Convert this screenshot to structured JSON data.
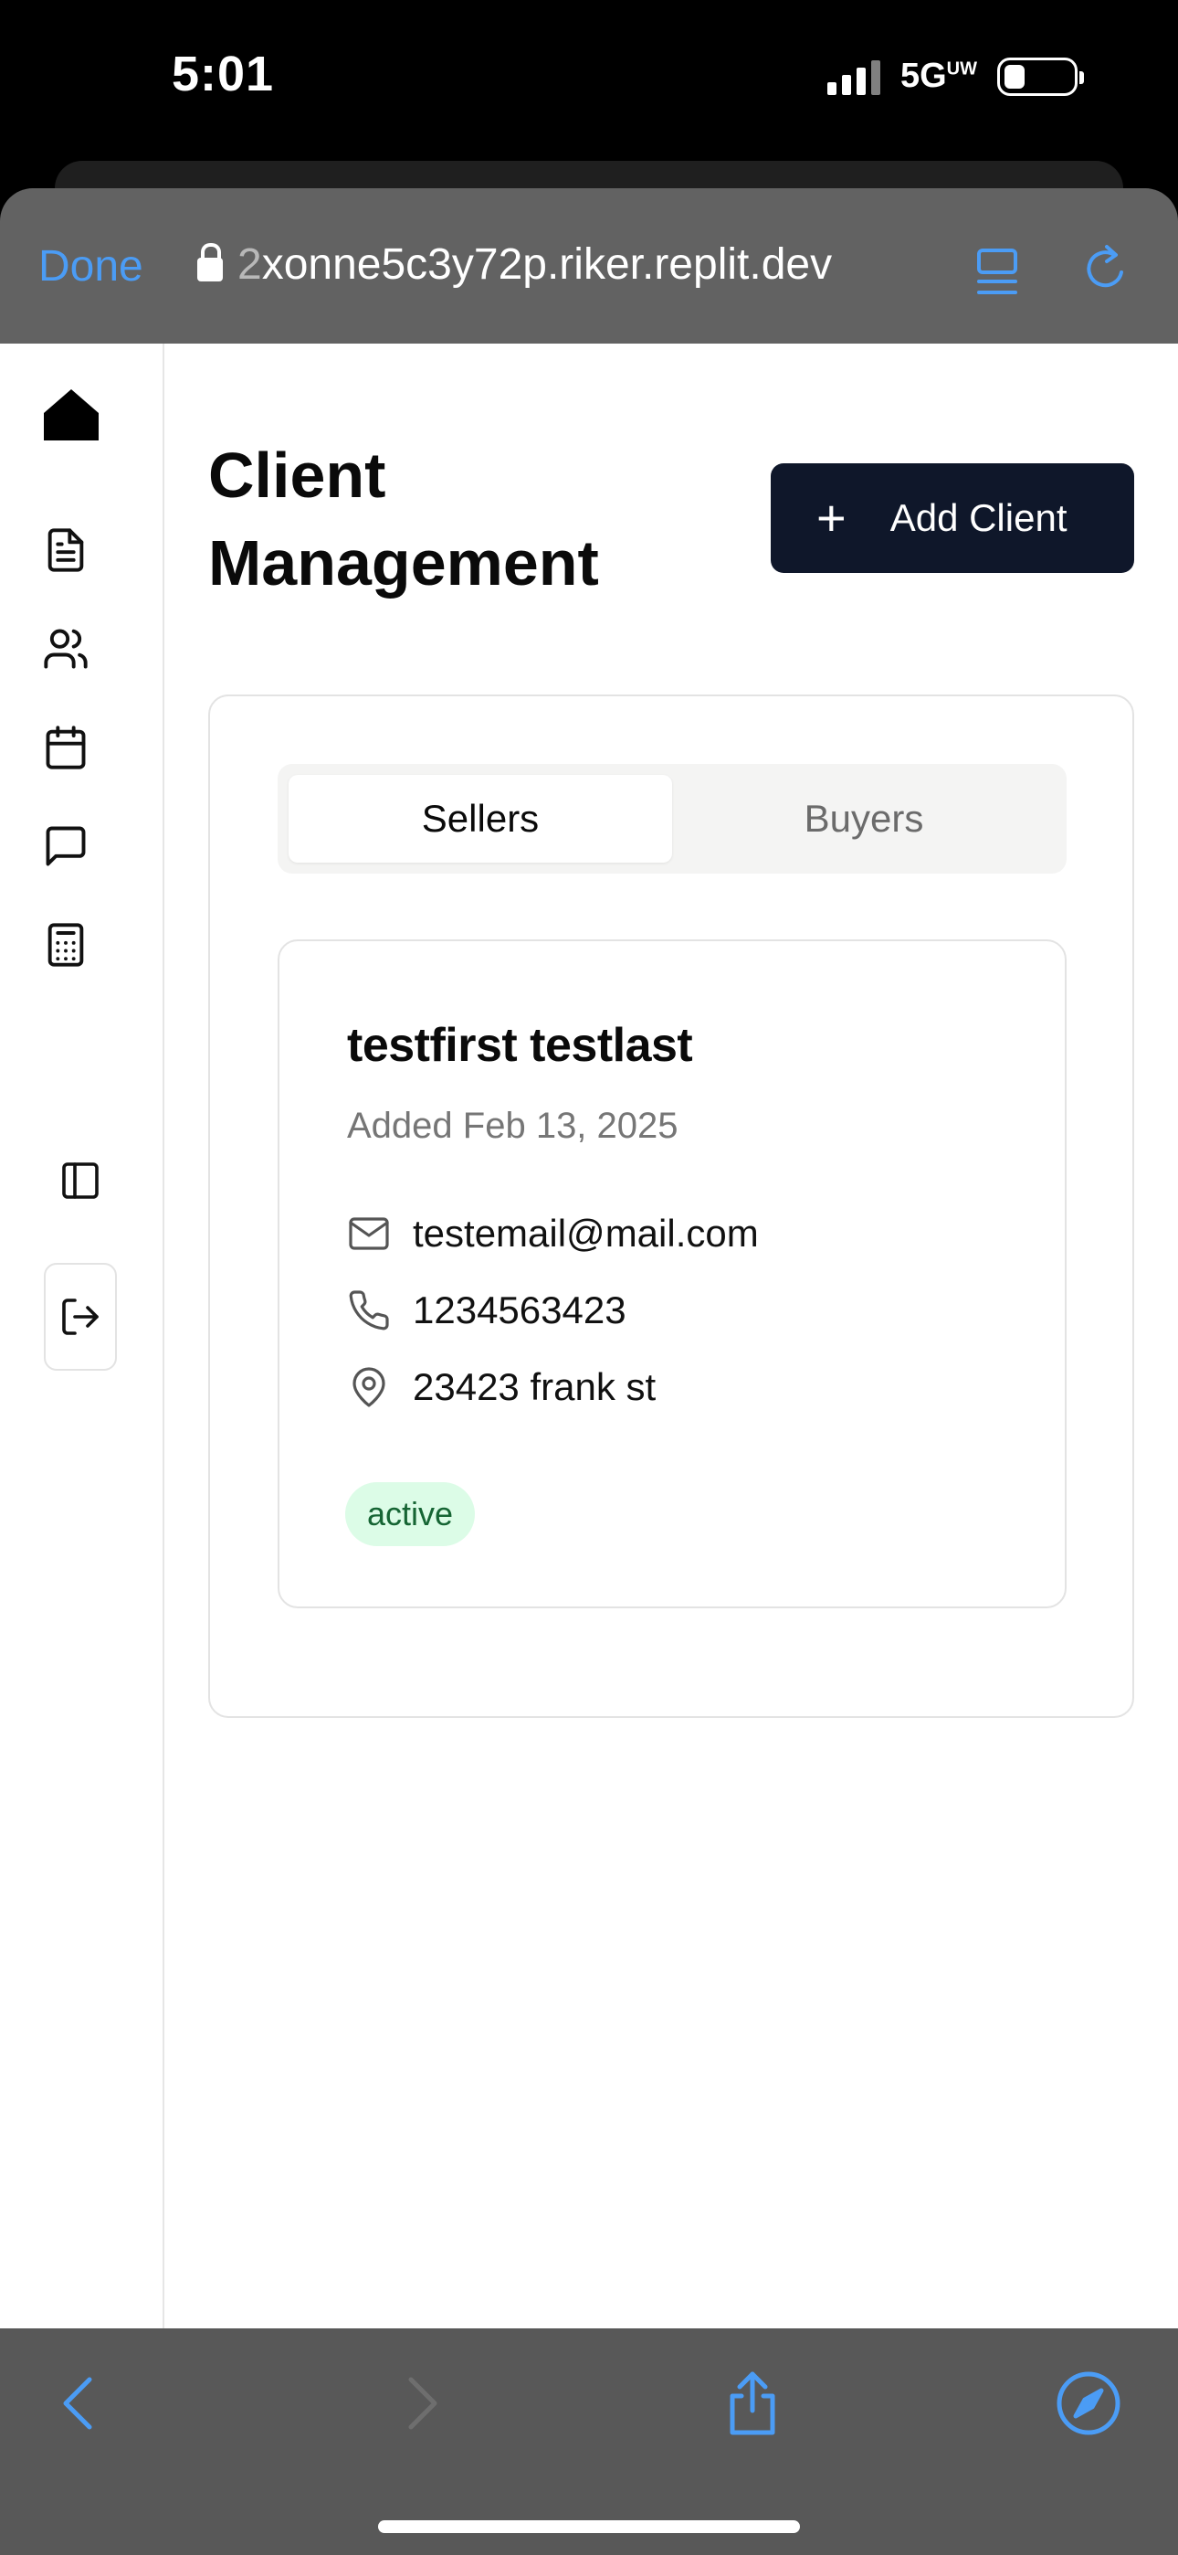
{
  "status_bar": {
    "time": "5:01",
    "network": "5G",
    "network_suffix": "UW"
  },
  "browser": {
    "done_label": "Done",
    "url_first_char": "2",
    "url_rest": "xonne5c3y72p.riker.replit.dev"
  },
  "sidebar": {
    "items": [
      "home-icon",
      "document-icon",
      "users-icon",
      "calendar-icon",
      "message-icon",
      "calculator-icon"
    ],
    "bottom_items": [
      "panel-toggle-icon",
      "logout-icon"
    ]
  },
  "header": {
    "title": "Client Management",
    "add_button_label": "Add Client"
  },
  "tabs": {
    "sellers": "Sellers",
    "buyers": "Buyers",
    "active": "Sellers"
  },
  "client": {
    "name": "testfirst testlast",
    "added": "Added Feb 13, 2025",
    "email": "testemail@mail.com",
    "phone": "1234563423",
    "address": "23423 frank st",
    "status": "active"
  },
  "colors": {
    "accent_blue": "#4b9cf5",
    "primary_button": "#0f172a",
    "badge_bg": "#dcfce7",
    "badge_text": "#166534"
  }
}
